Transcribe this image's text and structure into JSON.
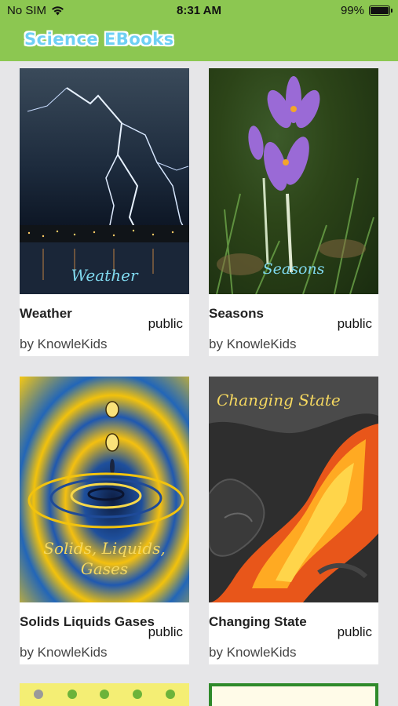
{
  "status_bar": {
    "carrier": "No SIM",
    "time": "8:31 AM",
    "battery": "99%"
  },
  "header": {
    "title": "Science EBooks"
  },
  "books": [
    {
      "cover_title": "Weather",
      "title": "Weather",
      "visibility": "public",
      "author": "by KnowleKids"
    },
    {
      "cover_title": "Seasons",
      "title": "Seasons",
      "visibility": "public",
      "author": "by KnowleKids"
    },
    {
      "cover_title": "Solids, Liquids, Gases",
      "title": "Solids Liquids Gases",
      "visibility": "public",
      "author": "by KnowleKids"
    },
    {
      "cover_title": "Changing State",
      "title": "Changing State",
      "visibility": "public",
      "author": "by KnowleKids"
    }
  ],
  "colors": {
    "header_bg": "#8cc751",
    "page_bg": "#e6e6e8",
    "title_fill": "#6fd0f4"
  }
}
